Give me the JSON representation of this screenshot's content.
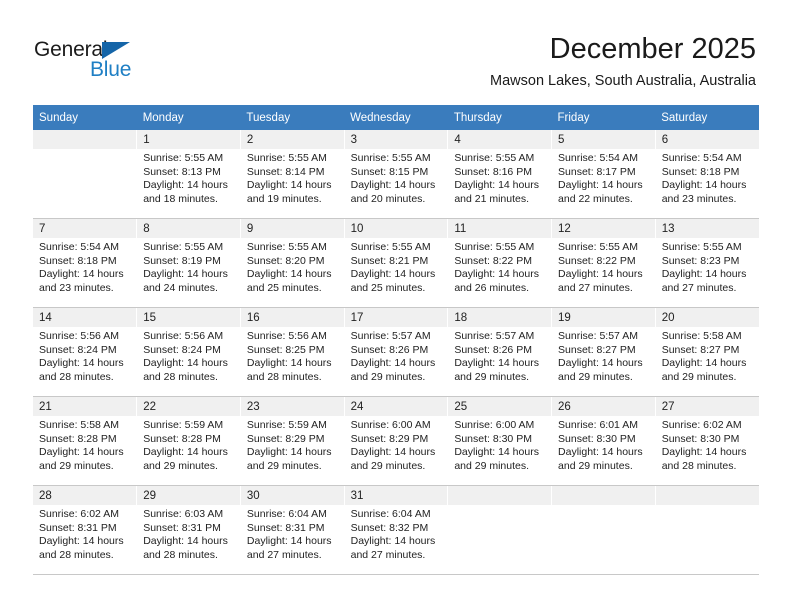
{
  "brand": {
    "name_part1": "General",
    "name_part2": "Blue",
    "accent_color": "#1f7fc4",
    "triangle_color": "#1565a8"
  },
  "header": {
    "month_title": "December 2025",
    "location": "Mawson Lakes, South Australia, Australia"
  },
  "calendar": {
    "header_bg": "#3a7cbd",
    "daynum_bg": "#f0f0f0",
    "weekday_headers": [
      "Sunday",
      "Monday",
      "Tuesday",
      "Wednesday",
      "Thursday",
      "Friday",
      "Saturday"
    ],
    "weeks": [
      [
        {
          "day": "",
          "sunrise": "",
          "sunset": "",
          "daylight_line1": "",
          "daylight_line2": ""
        },
        {
          "day": "1",
          "sunrise": "Sunrise: 5:55 AM",
          "sunset": "Sunset: 8:13 PM",
          "daylight_line1": "Daylight: 14 hours",
          "daylight_line2": "and 18 minutes."
        },
        {
          "day": "2",
          "sunrise": "Sunrise: 5:55 AM",
          "sunset": "Sunset: 8:14 PM",
          "daylight_line1": "Daylight: 14 hours",
          "daylight_line2": "and 19 minutes."
        },
        {
          "day": "3",
          "sunrise": "Sunrise: 5:55 AM",
          "sunset": "Sunset: 8:15 PM",
          "daylight_line1": "Daylight: 14 hours",
          "daylight_line2": "and 20 minutes."
        },
        {
          "day": "4",
          "sunrise": "Sunrise: 5:55 AM",
          "sunset": "Sunset: 8:16 PM",
          "daylight_line1": "Daylight: 14 hours",
          "daylight_line2": "and 21 minutes."
        },
        {
          "day": "5",
          "sunrise": "Sunrise: 5:54 AM",
          "sunset": "Sunset: 8:17 PM",
          "daylight_line1": "Daylight: 14 hours",
          "daylight_line2": "and 22 minutes."
        },
        {
          "day": "6",
          "sunrise": "Sunrise: 5:54 AM",
          "sunset": "Sunset: 8:18 PM",
          "daylight_line1": "Daylight: 14 hours",
          "daylight_line2": "and 23 minutes."
        }
      ],
      [
        {
          "day": "7",
          "sunrise": "Sunrise: 5:54 AM",
          "sunset": "Sunset: 8:18 PM",
          "daylight_line1": "Daylight: 14 hours",
          "daylight_line2": "and 23 minutes."
        },
        {
          "day": "8",
          "sunrise": "Sunrise: 5:55 AM",
          "sunset": "Sunset: 8:19 PM",
          "daylight_line1": "Daylight: 14 hours",
          "daylight_line2": "and 24 minutes."
        },
        {
          "day": "9",
          "sunrise": "Sunrise: 5:55 AM",
          "sunset": "Sunset: 8:20 PM",
          "daylight_line1": "Daylight: 14 hours",
          "daylight_line2": "and 25 minutes."
        },
        {
          "day": "10",
          "sunrise": "Sunrise: 5:55 AM",
          "sunset": "Sunset: 8:21 PM",
          "daylight_line1": "Daylight: 14 hours",
          "daylight_line2": "and 25 minutes."
        },
        {
          "day": "11",
          "sunrise": "Sunrise: 5:55 AM",
          "sunset": "Sunset: 8:22 PM",
          "daylight_line1": "Daylight: 14 hours",
          "daylight_line2": "and 26 minutes."
        },
        {
          "day": "12",
          "sunrise": "Sunrise: 5:55 AM",
          "sunset": "Sunset: 8:22 PM",
          "daylight_line1": "Daylight: 14 hours",
          "daylight_line2": "and 27 minutes."
        },
        {
          "day": "13",
          "sunrise": "Sunrise: 5:55 AM",
          "sunset": "Sunset: 8:23 PM",
          "daylight_line1": "Daylight: 14 hours",
          "daylight_line2": "and 27 minutes."
        }
      ],
      [
        {
          "day": "14",
          "sunrise": "Sunrise: 5:56 AM",
          "sunset": "Sunset: 8:24 PM",
          "daylight_line1": "Daylight: 14 hours",
          "daylight_line2": "and 28 minutes."
        },
        {
          "day": "15",
          "sunrise": "Sunrise: 5:56 AM",
          "sunset": "Sunset: 8:24 PM",
          "daylight_line1": "Daylight: 14 hours",
          "daylight_line2": "and 28 minutes."
        },
        {
          "day": "16",
          "sunrise": "Sunrise: 5:56 AM",
          "sunset": "Sunset: 8:25 PM",
          "daylight_line1": "Daylight: 14 hours",
          "daylight_line2": "and 28 minutes."
        },
        {
          "day": "17",
          "sunrise": "Sunrise: 5:57 AM",
          "sunset": "Sunset: 8:26 PM",
          "daylight_line1": "Daylight: 14 hours",
          "daylight_line2": "and 29 minutes."
        },
        {
          "day": "18",
          "sunrise": "Sunrise: 5:57 AM",
          "sunset": "Sunset: 8:26 PM",
          "daylight_line1": "Daylight: 14 hours",
          "daylight_line2": "and 29 minutes."
        },
        {
          "day": "19",
          "sunrise": "Sunrise: 5:57 AM",
          "sunset": "Sunset: 8:27 PM",
          "daylight_line1": "Daylight: 14 hours",
          "daylight_line2": "and 29 minutes."
        },
        {
          "day": "20",
          "sunrise": "Sunrise: 5:58 AM",
          "sunset": "Sunset: 8:27 PM",
          "daylight_line1": "Daylight: 14 hours",
          "daylight_line2": "and 29 minutes."
        }
      ],
      [
        {
          "day": "21",
          "sunrise": "Sunrise: 5:58 AM",
          "sunset": "Sunset: 8:28 PM",
          "daylight_line1": "Daylight: 14 hours",
          "daylight_line2": "and 29 minutes."
        },
        {
          "day": "22",
          "sunrise": "Sunrise: 5:59 AM",
          "sunset": "Sunset: 8:28 PM",
          "daylight_line1": "Daylight: 14 hours",
          "daylight_line2": "and 29 minutes."
        },
        {
          "day": "23",
          "sunrise": "Sunrise: 5:59 AM",
          "sunset": "Sunset: 8:29 PM",
          "daylight_line1": "Daylight: 14 hours",
          "daylight_line2": "and 29 minutes."
        },
        {
          "day": "24",
          "sunrise": "Sunrise: 6:00 AM",
          "sunset": "Sunset: 8:29 PM",
          "daylight_line1": "Daylight: 14 hours",
          "daylight_line2": "and 29 minutes."
        },
        {
          "day": "25",
          "sunrise": "Sunrise: 6:00 AM",
          "sunset": "Sunset: 8:30 PM",
          "daylight_line1": "Daylight: 14 hours",
          "daylight_line2": "and 29 minutes."
        },
        {
          "day": "26",
          "sunrise": "Sunrise: 6:01 AM",
          "sunset": "Sunset: 8:30 PM",
          "daylight_line1": "Daylight: 14 hours",
          "daylight_line2": "and 29 minutes."
        },
        {
          "day": "27",
          "sunrise": "Sunrise: 6:02 AM",
          "sunset": "Sunset: 8:30 PM",
          "daylight_line1": "Daylight: 14 hours",
          "daylight_line2": "and 28 minutes."
        }
      ],
      [
        {
          "day": "28",
          "sunrise": "Sunrise: 6:02 AM",
          "sunset": "Sunset: 8:31 PM",
          "daylight_line1": "Daylight: 14 hours",
          "daylight_line2": "and 28 minutes."
        },
        {
          "day": "29",
          "sunrise": "Sunrise: 6:03 AM",
          "sunset": "Sunset: 8:31 PM",
          "daylight_line1": "Daylight: 14 hours",
          "daylight_line2": "and 28 minutes."
        },
        {
          "day": "30",
          "sunrise": "Sunrise: 6:04 AM",
          "sunset": "Sunset: 8:31 PM",
          "daylight_line1": "Daylight: 14 hours",
          "daylight_line2": "and 27 minutes."
        },
        {
          "day": "31",
          "sunrise": "Sunrise: 6:04 AM",
          "sunset": "Sunset: 8:32 PM",
          "daylight_line1": "Daylight: 14 hours",
          "daylight_line2": "and 27 minutes."
        },
        {
          "day": "",
          "sunrise": "",
          "sunset": "",
          "daylight_line1": "",
          "daylight_line2": ""
        },
        {
          "day": "",
          "sunrise": "",
          "sunset": "",
          "daylight_line1": "",
          "daylight_line2": ""
        },
        {
          "day": "",
          "sunrise": "",
          "sunset": "",
          "daylight_line1": "",
          "daylight_line2": ""
        }
      ]
    ]
  }
}
